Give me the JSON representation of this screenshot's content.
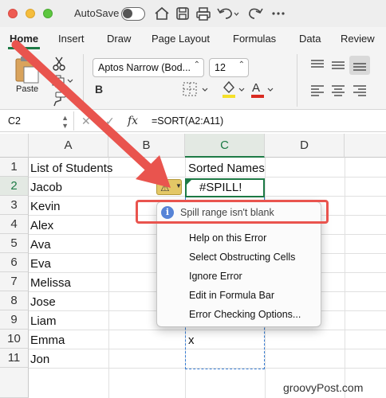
{
  "titlebar": {
    "autosave_label": "AutoSave"
  },
  "ribbon": {
    "tabs": [
      "Home",
      "Insert",
      "Draw",
      "Page Layout",
      "Formulas",
      "Data",
      "Review"
    ],
    "paste_label": "Paste",
    "font_name": "Aptos Narrow (Bod...",
    "font_size": "12"
  },
  "formula_bar": {
    "name_box": "C2",
    "fx_label": "fx",
    "formula": "=SORT(A2:A11)"
  },
  "grid": {
    "columns": [
      "A",
      "B",
      "C",
      "D"
    ],
    "rows": [
      "1",
      "2",
      "3",
      "4",
      "5",
      "6",
      "7",
      "8",
      "9",
      "10",
      "11"
    ],
    "cells": {
      "A1": "List of Students",
      "A2": "Jacob",
      "A3": "Kevin",
      "A4": "Alex",
      "A5": "Ava",
      "A6": "Eva",
      "A7": "Melissa",
      "A8": "Jose",
      "A9": "Liam",
      "A10": "Emma",
      "A11": "Jon",
      "C1": "Sorted Names",
      "C2": "#SPILL!",
      "C10": "x"
    },
    "selected_cell": "C2"
  },
  "error_menu": {
    "title": "Spill range isn't blank",
    "items": [
      "Help on this Error",
      "Select Obstructing Cells",
      "Ignore Error",
      "Edit in Formula Bar",
      "Error Checking Options..."
    ]
  },
  "watermark": "groovyPost.com",
  "colors": {
    "accent_green": "#1d7a45",
    "arrow_red": "#e9544e",
    "warning_yellow": "#e3c766",
    "info_blue": "#3a6fd0"
  }
}
